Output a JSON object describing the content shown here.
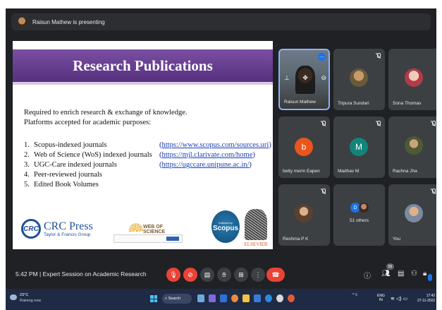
{
  "presenter_bar": {
    "text": "Raisun Mathew is presenting"
  },
  "slide": {
    "title": "Research Publications",
    "intro_line1": "Required to enrich research & exchange of knowledge.",
    "intro_line2": "Platforms accepted for academic purposes:",
    "items": [
      {
        "num": "1.",
        "label": "Scopus-indexed journals",
        "link": "https://www.scopus.com/sources.uri"
      },
      {
        "num": "2.",
        "label": "Web of Science (WoS) indexed journals",
        "link": "https://mjl.clarivate.com/home"
      },
      {
        "num": "3.",
        "label": "UGC-Care indexed journals",
        "link": "https://ugccare.unipune.ac.in/"
      },
      {
        "num": "4.",
        "label": "Peer-reviewed journals",
        "link": ""
      },
      {
        "num": "5.",
        "label": "Edited Book Volumes",
        "link": ""
      }
    ],
    "logos": {
      "crc_mark": "CRC",
      "crc_name": "CRC Press",
      "crc_sub": "Taylor & Francis Group",
      "wos": "WEB OF SCIENCE",
      "scopus_small": "Indexed by",
      "scopus": "Scopus",
      "elsevier": "ELSEVIER"
    }
  },
  "participants": [
    {
      "name": "Raisun Mathew",
      "type": "video",
      "muted": false
    },
    {
      "name": "Tripura Sundari",
      "type": "photo",
      "muted": true,
      "color": "#6b5a3a"
    },
    {
      "name": "Sona Thomas",
      "type": "photo",
      "muted": false,
      "color": "#d9a6a6"
    },
    {
      "name": "betty merin Eapen",
      "type": "letter",
      "letter": "b",
      "muted": true,
      "color": "#e8551d"
    },
    {
      "name": "Madhav M",
      "type": "letter",
      "letter": "M",
      "muted": true,
      "color": "#12857a"
    },
    {
      "name": "Rachna Jha",
      "type": "photo",
      "muted": true,
      "color": "#6a6f4a"
    },
    {
      "name": "Reshma P K",
      "type": "photo",
      "muted": true,
      "color": "#8a6a52"
    },
    {
      "name": "51 others",
      "type": "group",
      "letter": "D",
      "muted": false,
      "color": "#1a73e8"
    },
    {
      "name": "You",
      "type": "photo",
      "muted": true,
      "color": "#c58a6a"
    }
  ],
  "meet_bar": {
    "time": "5:42 PM",
    "separator": "|",
    "meeting_title": "Expert Session on Academic Research",
    "people_count": "59"
  },
  "taskbar": {
    "temperature": "23°C",
    "weather": "Raining now",
    "search": "Search",
    "lang_top": "ENG",
    "lang_bottom": "IN",
    "clock_time": "17:42",
    "clock_date": "27-11-2022"
  },
  "colors": {
    "meet_bg": "#202124",
    "tile_bg": "#3c4043",
    "slide_header": "#6a3f93",
    "danger": "#ea4335",
    "accent": "#1a73e8"
  }
}
